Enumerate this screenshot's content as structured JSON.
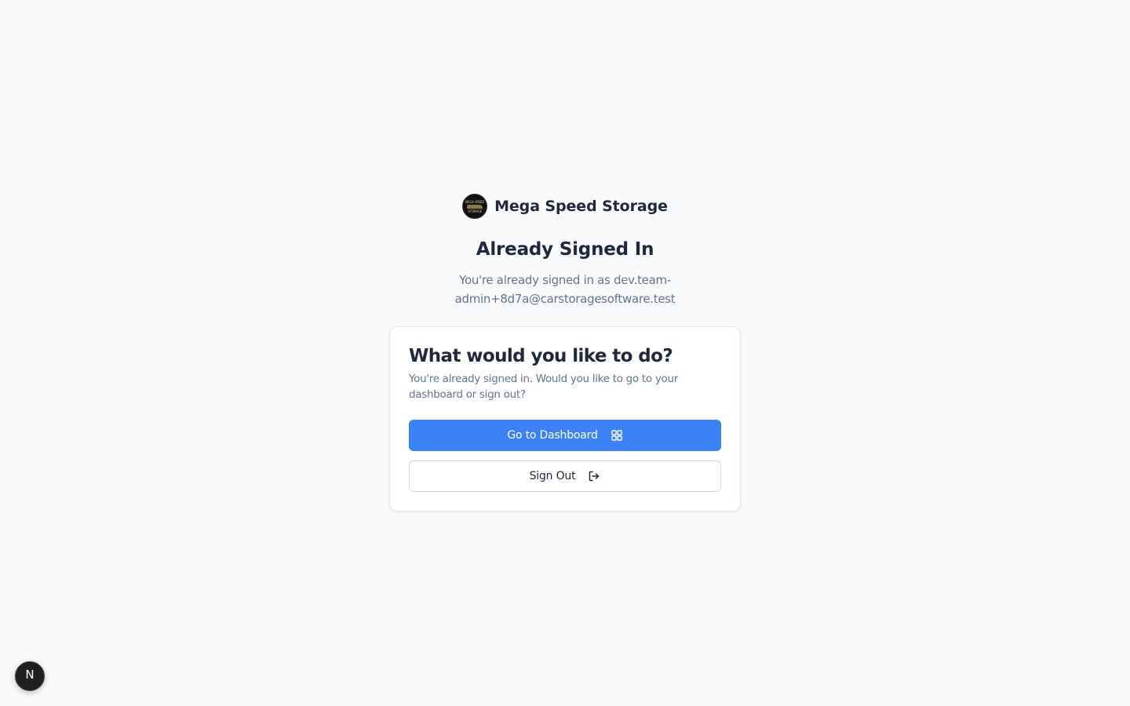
{
  "brand": {
    "name": "Mega Speed Storage",
    "logo_text_top": "MEGA SPEED",
    "logo_text_bottom": "STORAGE"
  },
  "header": {
    "title": "Already Signed In",
    "subtitle": "You're already signed in as dev.team-admin+8d7a@carstoragesoftware.test"
  },
  "card": {
    "title": "What would you like to do?",
    "description": "You're already signed in. Would you like to go to your dashboard or sign out?",
    "primary_button": {
      "label": "Go to Dashboard",
      "icon": "layout-grid-icon"
    },
    "secondary_button": {
      "label": "Sign Out",
      "icon": "log-out-icon"
    }
  },
  "dev_badge": {
    "label": "N",
    "icon": "nextjs-icon"
  },
  "colors": {
    "background": "#f8fafc",
    "primary": "#3b82f6",
    "text": "#1e293b",
    "muted": "#64748b",
    "border": "#e2e8f0"
  }
}
